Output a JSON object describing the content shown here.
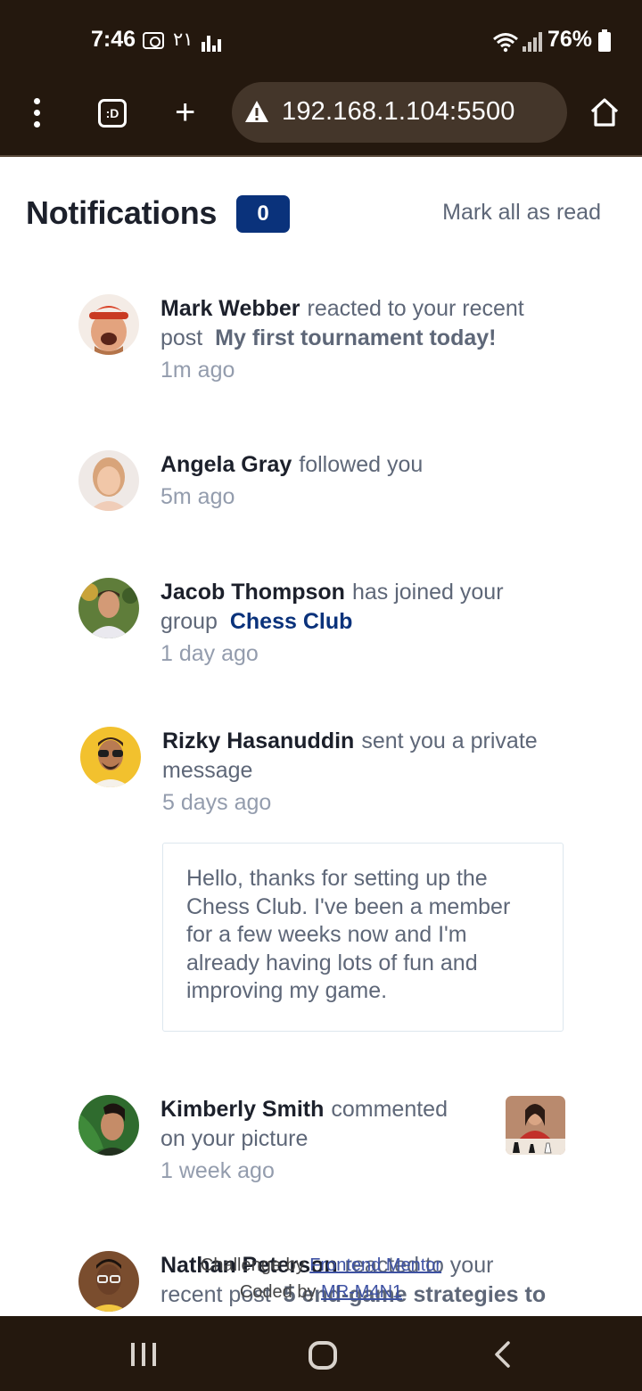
{
  "status_bar": {
    "time": "7:46",
    "indicator_text": "٢١",
    "battery": "76%",
    "icons": [
      "camera-icon",
      "signal-bars-icon",
      "wifi-icon",
      "cell-signal-icon",
      "battery-icon"
    ]
  },
  "browser": {
    "url": "192.168.1.104:5500",
    "tabs_label": ":D",
    "icons": [
      "menu-dots-icon",
      "tabs-icon",
      "plus-icon",
      "warning-icon",
      "home-icon"
    ]
  },
  "header": {
    "title": "Notifications",
    "unread_count": "0",
    "mark_all": "Mark all as read"
  },
  "notifications": [
    {
      "name": "Mark Webber",
      "action": "reacted to your recent post",
      "post": "My first tournament today!",
      "time": "1m ago"
    },
    {
      "name": "Angela Gray",
      "action": "followed you",
      "time": "5m ago"
    },
    {
      "name": "Jacob Thompson",
      "action": "has joined your group",
      "group": "Chess Club",
      "time": "1 day ago"
    },
    {
      "name": "Rizky Hasanuddin",
      "action": "sent you a private message",
      "time": "5 days ago",
      "message": "Hello, thanks for setting up the Chess Club. I've been a member for a few weeks now and I'm already having lots of fun and improving my game."
    },
    {
      "name": "Kimberly Smith",
      "action": "commented on your picture",
      "time": "1 week ago"
    },
    {
      "name": "Nathan Peterson",
      "action": "reacted to your recent post",
      "post": "5 end-game strategies to"
    }
  ],
  "attribution": {
    "challenge_prefix": "Challenge by",
    "challenge_link": "Frontend Mentor",
    "coded_prefix": "Coded by",
    "coded_link": "MR-M4N1"
  },
  "colors": {
    "header_bar": "#24180e",
    "url_bar": "#44362a",
    "badge": "#0a327b",
    "text_dark": "#1c202b",
    "text_grey": "#5e6778",
    "text_light": "#939cad",
    "border": "#dde7ee"
  },
  "nav_bar": {
    "icons": [
      "recent-apps-icon",
      "home-circle-icon",
      "back-icon"
    ]
  }
}
